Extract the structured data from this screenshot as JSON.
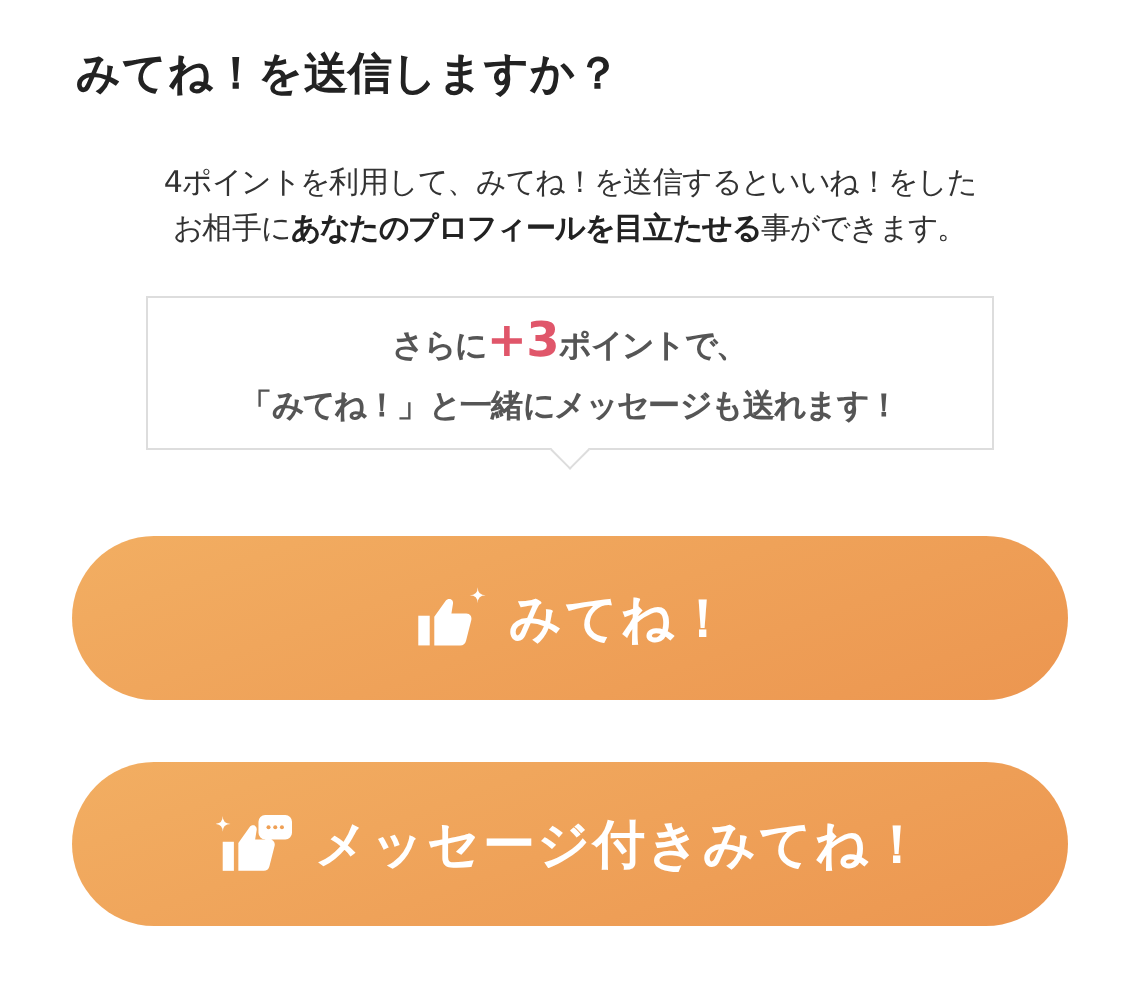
{
  "title": "みてね！を送信しますか？",
  "description_lines": [
    "4ポイントを利用して、みてね！を送信するといいね！をした",
    "お相手に**あなたのプロフィールを目立たせる**事ができます。"
  ],
  "callout": {
    "prefix": "さらに",
    "highlight": "+3",
    "suffix": "ポイントで、",
    "line_2": "「みてね！」と一緒にメッセージも送れます！"
  },
  "buttons": [
    {
      "kind": "like",
      "label": "みてね！"
    },
    {
      "kind": "like_message",
      "label": "メッセージ付きみてね！"
    }
  ]
}
